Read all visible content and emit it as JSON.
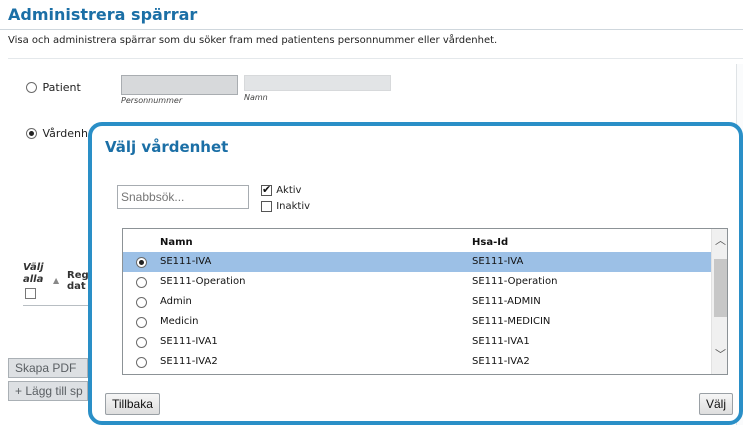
{
  "page": {
    "title": "Administrera spärrar",
    "subtitle": "Visa och administrera spärrar som du söker fram med patientens personnummer eller vårdenhet.",
    "radio_patient_label": "Patient",
    "radio_vardenhet_label": "Vårdenhe",
    "personnummer_label": "Personnummer",
    "namn_label": "Namn",
    "col_valj_alla_1": "Välj",
    "col_valj_alla_2": "alla",
    "col_reg_1": "Reg",
    "col_reg_2": "dat",
    "skapa_pdf_label": "Skapa PDF",
    "lagg_till_label": "+ Lägg till sp"
  },
  "modal": {
    "title": "Välj vårdenhet",
    "search_placeholder": "Snabbsök...",
    "filters": [
      {
        "label": "Aktiv",
        "checked": true
      },
      {
        "label": "Inaktiv",
        "checked": false
      }
    ],
    "columns": [
      "Namn",
      "Hsa-Id"
    ],
    "rows": [
      {
        "name": "SE111-IVA",
        "hsa_id": "SE111-IVA",
        "selected": true
      },
      {
        "name": "SE111-Operation",
        "hsa_id": "SE111-Operation",
        "selected": false
      },
      {
        "name": "Admin",
        "hsa_id": "SE111-ADMIN",
        "selected": false
      },
      {
        "name": "Medicin",
        "hsa_id": "SE111-MEDICIN",
        "selected": false
      },
      {
        "name": "SE111-IVA1",
        "hsa_id": "SE111-IVA1",
        "selected": false
      },
      {
        "name": "SE111-IVA2",
        "hsa_id": "SE111-IVA2",
        "selected": false
      }
    ],
    "back_label": "Tillbaka",
    "select_label": "Välj"
  },
  "colors": {
    "accent": "#2a8fc7",
    "title": "#1b6fa6",
    "selected_row": "#9cc0e6"
  }
}
